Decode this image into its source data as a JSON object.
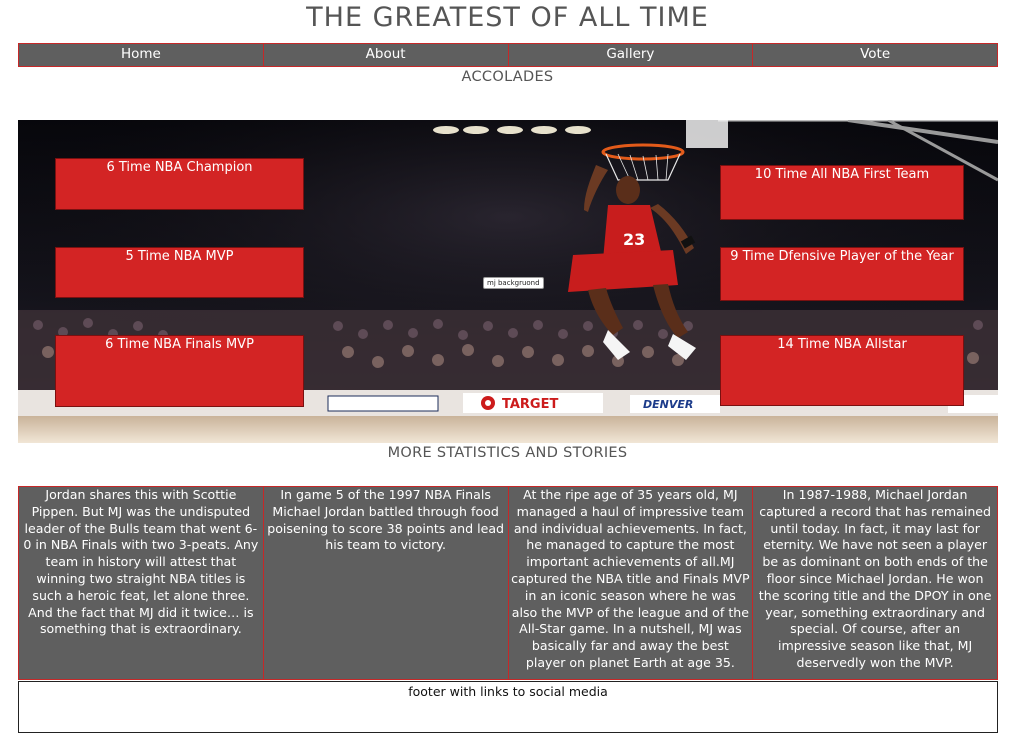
{
  "header": {
    "title": "THE GREATEST OF ALL TIME"
  },
  "nav": {
    "items": [
      {
        "label": "Home"
      },
      {
        "label": "About"
      },
      {
        "label": "Gallery"
      },
      {
        "label": "Vote"
      }
    ]
  },
  "accolades": {
    "heading": "ACCOLADES",
    "image_alt": "mj backgruond",
    "items": [
      {
        "label": "6 Time NBA Champion"
      },
      {
        "label": "5 Time NBA MVP"
      },
      {
        "label": "6 Time NBA Finals MVP"
      },
      {
        "label": "10 Time All NBA First Team"
      },
      {
        "label": "9 Time Dfensive Player of the Year"
      },
      {
        "label": "14 Time NBA Allstar"
      }
    ],
    "arena_signs": [
      "TARGET",
      "DENVER"
    ]
  },
  "more": {
    "heading": "MORE STATISTICS AND STORIES",
    "stories": [
      {
        "text": "Jordan shares this with Scottie Pippen. But MJ was the undisputed leader of the Bulls team that went 6-0 in NBA Finals with two 3-peats. Any team in history will attest that winning two straight NBA titles is such a heroic feat, let alone three. And the fact that MJ did it twice… is something that is extraordinary."
      },
      {
        "text": "In game 5 of the 1997 NBA Finals Michael Jordan battled through food poisening to score 38 points and lead his team to victory."
      },
      {
        "text": "At the ripe age of 35 years old, MJ managed a haul of impressive team and individual achievements. In fact, he managed to capture the most important achievements of all.MJ captured the NBA title and Finals MVP in an iconic season where he was also the MVP of the league and of the All-Star game. In a nutshell, MJ was basically far and away the best player on planet Earth at age 35."
      },
      {
        "text": "In 1987-1988, Michael Jordan captured a record that has remained until today. In fact, it may last for eternity. We have not seen a player be as dominant on both ends of the floor since Michael Jordan. He won the scoring title and the DPOY in one year, something extraordinary and special. Of course, after an impressive season like that, MJ deservedly won the MVP."
      }
    ]
  },
  "footer": {
    "text": "footer with links to social media"
  },
  "colors": {
    "nav_bg": "#5f5f5f",
    "accent_red": "#d32424",
    "border_red": "#c62828"
  }
}
